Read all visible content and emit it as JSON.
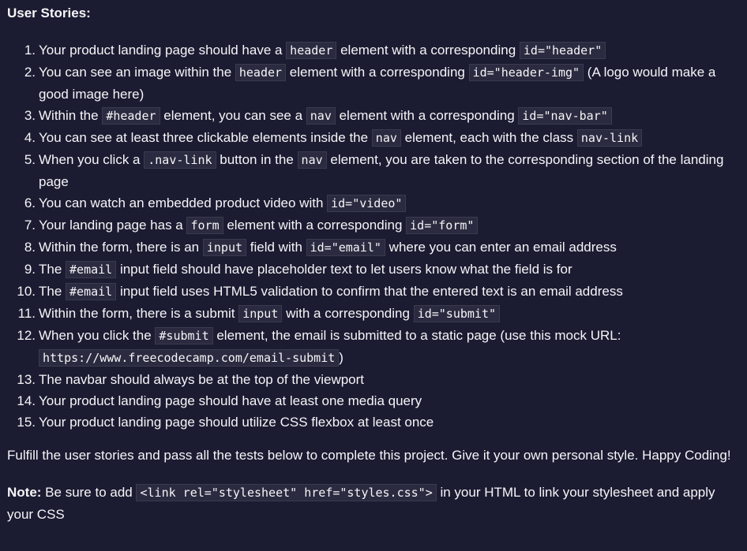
{
  "heading": "User Stories:",
  "stories": [
    {
      "num": "1.",
      "parts": [
        "Your product landing page should have a ",
        "header",
        " element with a corresponding ",
        "id=\"header\"",
        ""
      ]
    },
    {
      "num": "2.",
      "parts": [
        "You can see an image within the ",
        "header",
        " element with a corresponding ",
        "id=\"header-img\"",
        " (A logo would make a good image here)"
      ]
    },
    {
      "num": "3.",
      "parts": [
        "Within the ",
        "#header",
        " element, you can see a ",
        "nav",
        " element with a corresponding ",
        "id=\"nav-bar\"",
        ""
      ]
    },
    {
      "num": "4.",
      "parts": [
        "You can see at least three clickable elements inside the ",
        "nav",
        " element, each with the class ",
        "nav-link",
        ""
      ]
    },
    {
      "num": "5.",
      "parts": [
        "When you click a ",
        ".nav-link",
        " button in the ",
        "nav",
        " element, you are taken to the corresponding section of the landing page"
      ]
    },
    {
      "num": "6.",
      "parts": [
        "You can watch an embedded product video with ",
        "id=\"video\"",
        ""
      ]
    },
    {
      "num": "7.",
      "parts": [
        "Your landing page has a ",
        "form",
        " element with a corresponding ",
        "id=\"form\"",
        ""
      ]
    },
    {
      "num": "8.",
      "parts": [
        "Within the form, there is an ",
        "input",
        " field with ",
        "id=\"email\"",
        " where you can enter an email address"
      ]
    },
    {
      "num": "9.",
      "parts": [
        "The ",
        "#email",
        " input field should have placeholder text to let users know what the field is for"
      ]
    },
    {
      "num": "10.",
      "parts": [
        "The ",
        "#email",
        " input field uses HTML5 validation to confirm that the entered text is an email address"
      ]
    },
    {
      "num": "11.",
      "parts": [
        "Within the form, there is a submit ",
        "input",
        " with a corresponding ",
        "id=\"submit\"",
        ""
      ]
    },
    {
      "num": "12.",
      "parts": [
        "When you click the ",
        "#submit",
        " element, the email is submitted to a static page (use this mock URL: ",
        "https://www.freecodecamp.com/email-submit",
        ")"
      ]
    },
    {
      "num": "13.",
      "parts": [
        "The navbar should always be at the top of the viewport"
      ]
    },
    {
      "num": "14.",
      "parts": [
        "Your product landing page should have at least one media query"
      ]
    },
    {
      "num": "15.",
      "parts": [
        "Your product landing page should utilize CSS flexbox at least once"
      ]
    }
  ],
  "paragraph1": "Fulfill the user stories and pass all the tests below to complete this project. Give it your own personal style. Happy Coding!",
  "note": {
    "label": "Note:",
    "text1": " Be sure to add ",
    "code": "<link rel=\"stylesheet\" href=\"styles.css\">",
    "text2": " in your HTML to link your stylesheet and apply your CSS"
  }
}
